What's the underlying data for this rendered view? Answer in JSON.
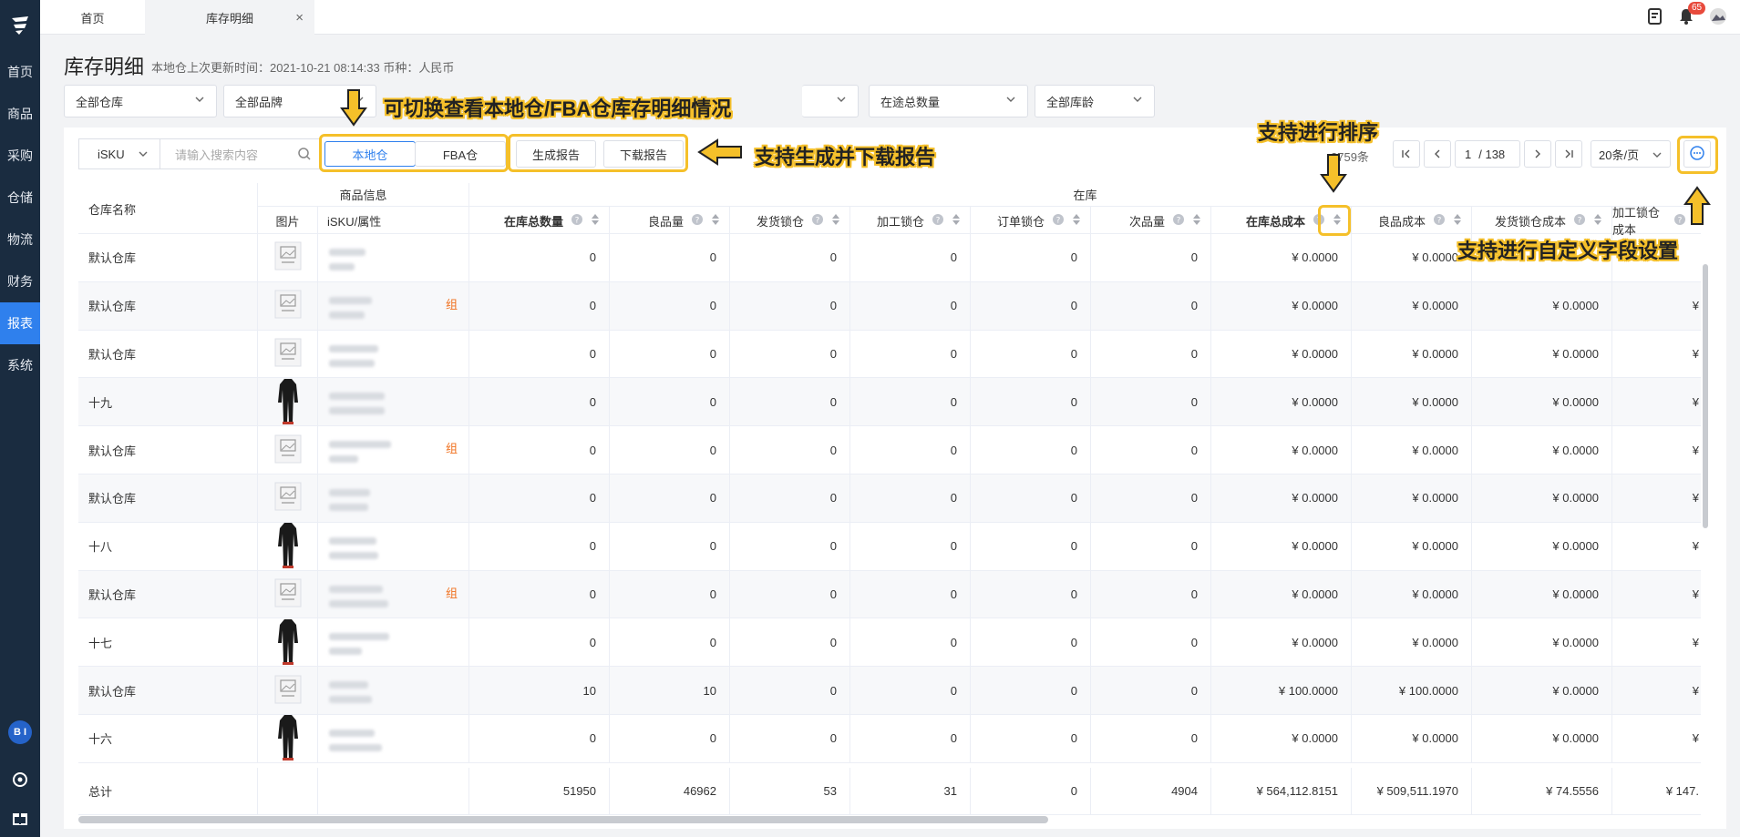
{
  "sidebar": {
    "items": [
      {
        "label": "首页"
      },
      {
        "label": "商品"
      },
      {
        "label": "采购"
      },
      {
        "label": "仓储"
      },
      {
        "label": "物流"
      },
      {
        "label": "财务"
      },
      {
        "label": "报表",
        "active": true
      },
      {
        "label": "系统"
      }
    ],
    "avatar": "B I"
  },
  "topbar": {
    "tabs": [
      {
        "label": "首页"
      },
      {
        "label": "库存明细"
      }
    ],
    "notification_count": "65"
  },
  "page": {
    "title": "库存明细",
    "subtitle": "本地仓上次更新时间：2021-10-21 08:14:33 币种：人民币"
  },
  "filters": {
    "warehouse": "全部仓库",
    "brand": "全部品牌",
    "in_transit": "在途总数量",
    "age": "全部库龄"
  },
  "toolbar": {
    "search_type": "iSKU",
    "search_placeholder": "请输入搜索内容",
    "local_tab": "本地仓",
    "fba_tab": "FBA仓",
    "generate_report": "生成报告",
    "download_report": "下载报告",
    "total_count": "2759条",
    "current_page": "1",
    "total_pages": "/ 138",
    "page_size": "20条/页"
  },
  "table": {
    "group_headers": {
      "product_info": "商品信息",
      "in_stock": "在库"
    },
    "headers": {
      "warehouse": "仓库名称",
      "image": "图片",
      "isku": "iSKU/属性",
      "total_qty": "在库总数量",
      "good_qty": "良品量",
      "ship_lock": "发货锁仓",
      "process_lock": "加工锁仓",
      "order_lock": "订单锁仓",
      "defective": "次品量",
      "total_cost": "在库总成本",
      "good_cost": "良品成本",
      "ship_lock_cost": "发货锁仓成本",
      "process_lock_cost": "加工锁仓成本"
    },
    "group_tag": "组",
    "rows": [
      {
        "warehouse": "默认仓库",
        "img": "placeholder",
        "tag": false,
        "total_qty": "0",
        "good_qty": "0",
        "ship_lock": "0",
        "process_lock": "0",
        "order_lock": "0",
        "defective": "0",
        "total_cost": "¥ 0.0000",
        "good_cost": "¥ 0.0000",
        "ship_lock_cost": "",
        "process_lock_cost": ""
      },
      {
        "warehouse": "默认仓库",
        "img": "placeholder",
        "tag": true,
        "total_qty": "0",
        "good_qty": "0",
        "ship_lock": "0",
        "process_lock": "0",
        "order_lock": "0",
        "defective": "0",
        "total_cost": "¥ 0.0000",
        "good_cost": "¥ 0.0000",
        "ship_lock_cost": "¥ 0.0000",
        "process_lock_cost": "¥"
      },
      {
        "warehouse": "默认仓库",
        "img": "placeholder",
        "tag": false,
        "total_qty": "0",
        "good_qty": "0",
        "ship_lock": "0",
        "process_lock": "0",
        "order_lock": "0",
        "defective": "0",
        "total_cost": "¥ 0.0000",
        "good_cost": "¥ 0.0000",
        "ship_lock_cost": "¥ 0.0000",
        "process_lock_cost": "¥"
      },
      {
        "warehouse": "十九",
        "img": "clothing",
        "tag": false,
        "total_qty": "0",
        "good_qty": "0",
        "ship_lock": "0",
        "process_lock": "0",
        "order_lock": "0",
        "defective": "0",
        "total_cost": "¥ 0.0000",
        "good_cost": "¥ 0.0000",
        "ship_lock_cost": "¥ 0.0000",
        "process_lock_cost": "¥"
      },
      {
        "warehouse": "默认仓库",
        "img": "placeholder",
        "tag": true,
        "total_qty": "0",
        "good_qty": "0",
        "ship_lock": "0",
        "process_lock": "0",
        "order_lock": "0",
        "defective": "0",
        "total_cost": "¥ 0.0000",
        "good_cost": "¥ 0.0000",
        "ship_lock_cost": "¥ 0.0000",
        "process_lock_cost": "¥"
      },
      {
        "warehouse": "默认仓库",
        "img": "placeholder",
        "tag": false,
        "total_qty": "0",
        "good_qty": "0",
        "ship_lock": "0",
        "process_lock": "0",
        "order_lock": "0",
        "defective": "0",
        "total_cost": "¥ 0.0000",
        "good_cost": "¥ 0.0000",
        "ship_lock_cost": "¥ 0.0000",
        "process_lock_cost": "¥"
      },
      {
        "warehouse": "十八",
        "img": "clothing",
        "tag": false,
        "total_qty": "0",
        "good_qty": "0",
        "ship_lock": "0",
        "process_lock": "0",
        "order_lock": "0",
        "defective": "0",
        "total_cost": "¥ 0.0000",
        "good_cost": "¥ 0.0000",
        "ship_lock_cost": "¥ 0.0000",
        "process_lock_cost": "¥"
      },
      {
        "warehouse": "默认仓库",
        "img": "placeholder",
        "tag": true,
        "total_qty": "0",
        "good_qty": "0",
        "ship_lock": "0",
        "process_lock": "0",
        "order_lock": "0",
        "defective": "0",
        "total_cost": "¥ 0.0000",
        "good_cost": "¥ 0.0000",
        "ship_lock_cost": "¥ 0.0000",
        "process_lock_cost": "¥"
      },
      {
        "warehouse": "十七",
        "img": "clothing",
        "tag": false,
        "total_qty": "0",
        "good_qty": "0",
        "ship_lock": "0",
        "process_lock": "0",
        "order_lock": "0",
        "defective": "0",
        "total_cost": "¥ 0.0000",
        "good_cost": "¥ 0.0000",
        "ship_lock_cost": "¥ 0.0000",
        "process_lock_cost": "¥"
      },
      {
        "warehouse": "默认仓库",
        "img": "placeholder",
        "tag": false,
        "total_qty": "10",
        "good_qty": "10",
        "ship_lock": "0",
        "process_lock": "0",
        "order_lock": "0",
        "defective": "0",
        "total_cost": "¥ 100.0000",
        "good_cost": "¥ 100.0000",
        "ship_lock_cost": "¥ 0.0000",
        "process_lock_cost": "¥"
      },
      {
        "warehouse": "十六",
        "img": "clothing",
        "tag": false,
        "total_qty": "0",
        "good_qty": "0",
        "ship_lock": "0",
        "process_lock": "0",
        "order_lock": "0",
        "defective": "0",
        "total_cost": "¥ 0.0000",
        "good_cost": "¥ 0.0000",
        "ship_lock_cost": "¥ 0.0000",
        "process_lock_cost": "¥"
      }
    ],
    "total": {
      "label": "总计",
      "total_qty": "51950",
      "good_qty": "46962",
      "ship_lock": "53",
      "process_lock": "31",
      "order_lock": "0",
      "defective": "4904",
      "total_cost": "¥ 564,112.8151",
      "good_cost": "¥ 509,511.1970",
      "ship_lock_cost": "¥ 74.5556",
      "process_lock_cost": "¥ 147."
    }
  },
  "annotations": {
    "switch": "可切换查看本地仓/FBA仓库存明细情况",
    "report": "支持生成并下载报告",
    "sort": "支持进行排序",
    "custom": "支持进行自定义字段设置"
  },
  "colors": {
    "sidebar": "#1a2c40",
    "accent": "#2f80ed",
    "highlight": "#f5c02a",
    "tag": "#f0711f"
  }
}
